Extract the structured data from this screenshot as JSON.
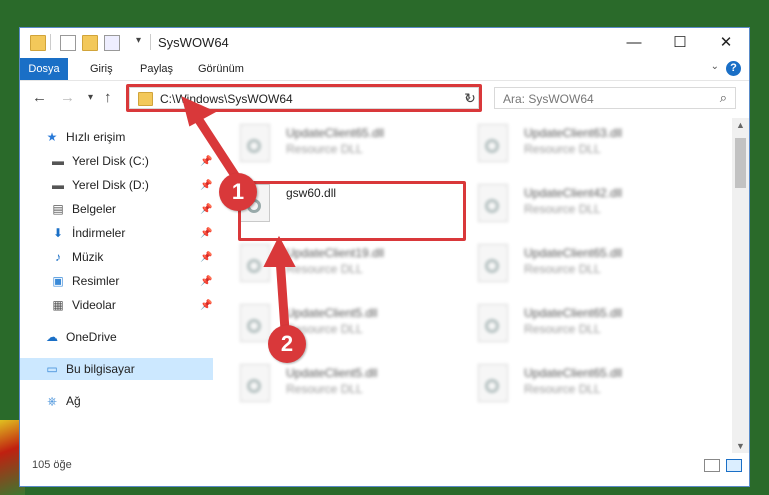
{
  "window": {
    "title": "SysWOW64",
    "controls": {
      "minimize": "—",
      "maximize": "☐",
      "close": "✕"
    }
  },
  "ribbon": {
    "tabs": [
      "Dosya",
      "Giriş",
      "Paylaş",
      "Görünüm"
    ],
    "help": "?"
  },
  "addressbar": {
    "path": "C:\\Windows\\SysWOW64",
    "search_placeholder": "Ara: SysWOW64"
  },
  "sidebar": {
    "quick_access": "Hızlı erişim",
    "items": [
      {
        "label": "Yerel Disk (C:)",
        "icon": "drive-icon"
      },
      {
        "label": "Yerel Disk (D:)",
        "icon": "drive-icon"
      },
      {
        "label": "Belgeler",
        "icon": "documents-icon"
      },
      {
        "label": "İndirmeler",
        "icon": "download-icon"
      },
      {
        "label": "Müzik",
        "icon": "music-icon"
      },
      {
        "label": "Resimler",
        "icon": "pictures-icon"
      },
      {
        "label": "Videolar",
        "icon": "videos-icon"
      }
    ],
    "onedrive": "OneDrive",
    "this_pc": "Bu bilgisayar",
    "network": "Ağ"
  },
  "files": {
    "left_column": [
      {
        "name": "UpdateClient65.dll",
        "type": "Resource DLL"
      },
      {
        "name": "gsw60.dll",
        "type": ""
      },
      {
        "name": "UpdateClient19.dll",
        "type": "Resource DLL"
      },
      {
        "name": "UpdateClient5.dll",
        "type": "Resource DLL"
      },
      {
        "name": "UpdateClient5.dll",
        "type": "Resource DLL"
      }
    ],
    "right_column": [
      {
        "name": "UpdateClient63.dll",
        "type": "Resource DLL"
      },
      {
        "name": "UpdateClient42.dll",
        "type": "Resource DLL"
      },
      {
        "name": "UpdateClient65.dll",
        "type": "Resource DLL"
      },
      {
        "name": "UpdateClient65.dll",
        "type": "Resource DLL"
      },
      {
        "name": "UpdateClient65.dll",
        "type": "Resource DLL"
      }
    ]
  },
  "status": {
    "count": "105 öğe"
  },
  "annotations": {
    "step1": "1",
    "step2": "2",
    "color": "#d9383a"
  }
}
